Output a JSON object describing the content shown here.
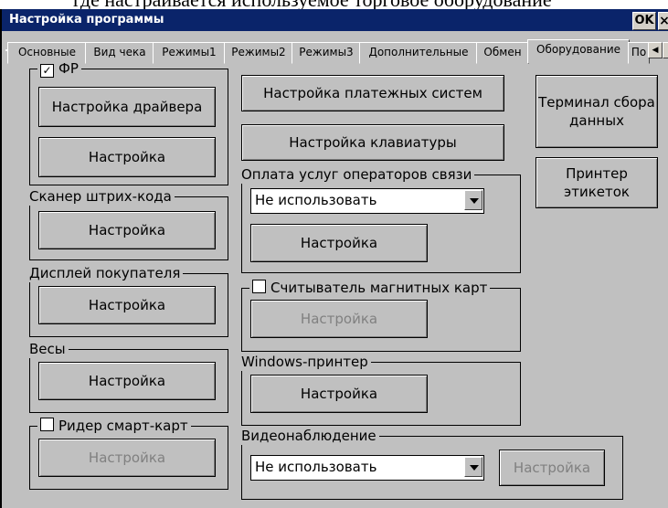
{
  "background_text": "где настраивается используемое торговое оборудование",
  "window": {
    "title": "Настройка программы",
    "ok_label": "OK",
    "close_label": "×"
  },
  "tabs": [
    "Основные",
    "Вид чека",
    "Режимы1",
    "Режимы2",
    "Режимы3",
    "Дополнительные",
    "Обмен",
    "Оборудование",
    "По"
  ],
  "active_tab": "Оборудование",
  "left": {
    "fr": {
      "label": "ФР",
      "checked": true,
      "driver_button": "Настройка драйвера",
      "setup_button": "Настройка"
    },
    "scanner": {
      "label": "Сканер штрих-кода",
      "setup_button": "Настройка"
    },
    "display": {
      "label": "Дисплей покупателя",
      "setup_button": "Настройка"
    },
    "scales": {
      "label": "Весы",
      "setup_button": "Настройка"
    },
    "smartcard": {
      "label": "Ридер смарт-карт",
      "checked": false,
      "setup_button": "Настройка"
    }
  },
  "middle": {
    "payment_systems_button": "Настройка платежных систем",
    "keyboard_button": "Настройка клавиатуры",
    "telecom": {
      "label": "Оплата услуг операторов связи",
      "select_value": "Не использовать",
      "setup_button": "Настройка"
    },
    "magnetic": {
      "label": "Считыватель магнитных карт",
      "checked": false,
      "setup_button": "Настройка"
    },
    "win_printer": {
      "label": "Windows-принтер",
      "setup_button": "Настройка"
    },
    "video": {
      "label": "Видеонаблюдение",
      "select_value": "Не использовать",
      "setup_button": "Настройка"
    }
  },
  "right": {
    "terminal_button": "Терминал сбора данных",
    "label_printer_button": "Принтер этикеток"
  }
}
